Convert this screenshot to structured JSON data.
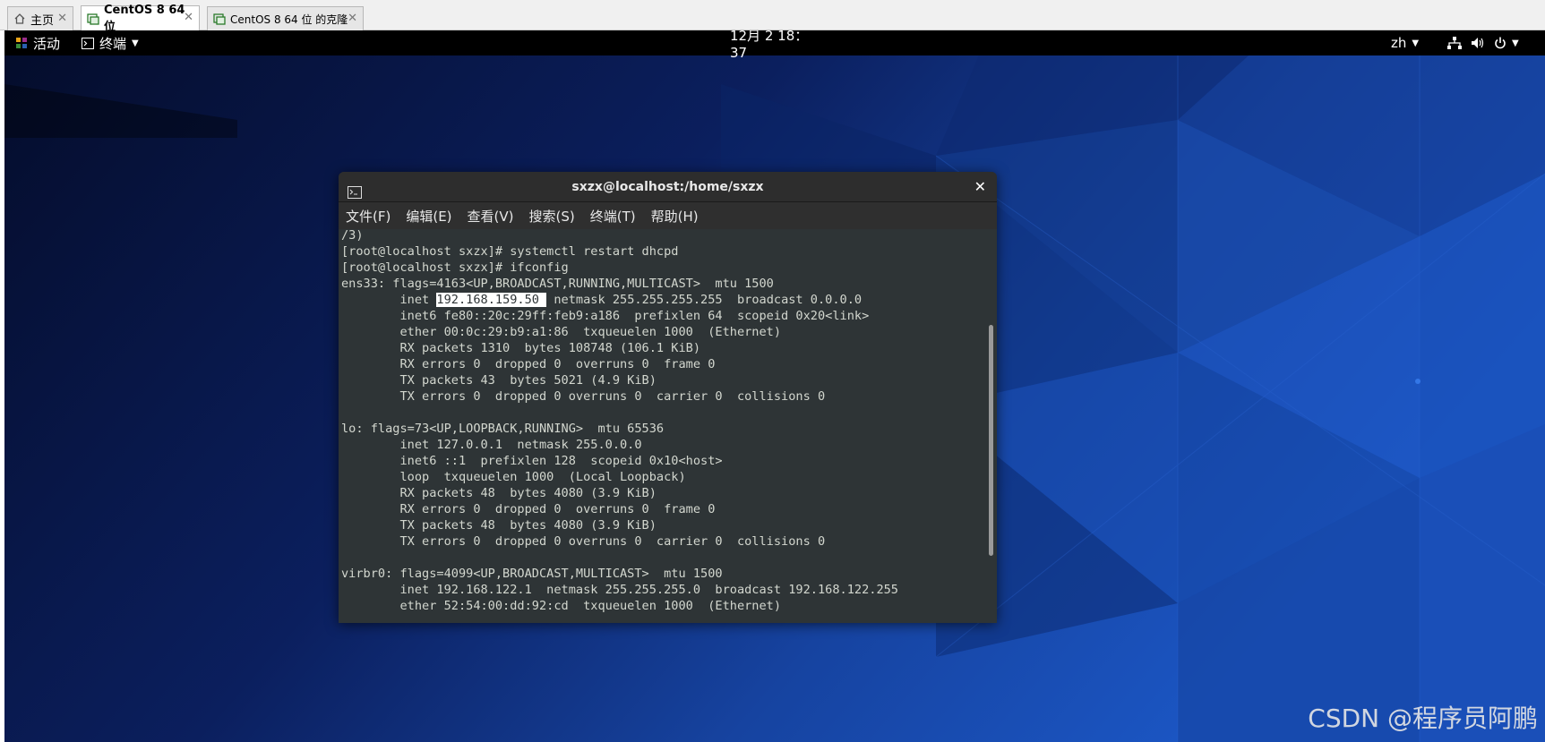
{
  "vm_tabs": [
    {
      "label": "主页",
      "active": false
    },
    {
      "label": "CentOS 8 64 位",
      "active": true
    },
    {
      "label": "CentOS 8 64 位 的克隆",
      "active": false
    }
  ],
  "topbar": {
    "activities": "活动",
    "app_menu": "终端",
    "clock": "12月 2  18：37",
    "lang": "zh"
  },
  "terminal": {
    "title": "sxzx@localhost:/home/sxzx",
    "menu": [
      "文件(F)",
      "编辑(E)",
      "查看(V)",
      "搜索(S)",
      "终端(T)",
      "帮助(H)"
    ],
    "lines": [
      "/3)",
      "[root@localhost sxzx]# systemctl restart dhcpd",
      "[root@localhost sxzx]# ifconfig",
      "ens33: flags=4163<UP,BROADCAST,RUNNING,MULTICAST>  mtu 1500",
      {
        "pre": "        inet ",
        "hl": "192.168.159.50 ",
        "post": " netmask 255.255.255.255  broadcast 0.0.0.0"
      },
      "        inet6 fe80::20c:29ff:feb9:a186  prefixlen 64  scopeid 0x20<link>",
      "        ether 00:0c:29:b9:a1:86  txqueuelen 1000  (Ethernet)",
      "        RX packets 1310  bytes 108748 (106.1 KiB)",
      "        RX errors 0  dropped 0  overruns 0  frame 0",
      "        TX packets 43  bytes 5021 (4.9 KiB)",
      "        TX errors 0  dropped 0 overruns 0  carrier 0  collisions 0",
      "",
      "lo: flags=73<UP,LOOPBACK,RUNNING>  mtu 65536",
      "        inet 127.0.0.1  netmask 255.0.0.0",
      "        inet6 ::1  prefixlen 128  scopeid 0x10<host>",
      "        loop  txqueuelen 1000  (Local Loopback)",
      "        RX packets 48  bytes 4080 (3.9 KiB)",
      "        RX errors 0  dropped 0  overruns 0  frame 0",
      "        TX packets 48  bytes 4080 (3.9 KiB)",
      "        TX errors 0  dropped 0 overruns 0  carrier 0  collisions 0",
      "",
      "virbr0: flags=4099<UP,BROADCAST,MULTICAST>  mtu 1500",
      "        inet 192.168.122.1  netmask 255.255.255.0  broadcast 192.168.122.255",
      "        ether 52:54:00:dd:92:cd  txqueuelen 1000  (Ethernet)"
    ]
  },
  "watermark": "CSDN @程序员阿鹏",
  "colors": {
    "terminal_bg": "#2e3436",
    "terminal_fg": "#d3d7cf",
    "topbar_bg": "#000000",
    "wallpaper_dark": "#0a1a4e",
    "wallpaper_blue": "#1a4fb0"
  }
}
